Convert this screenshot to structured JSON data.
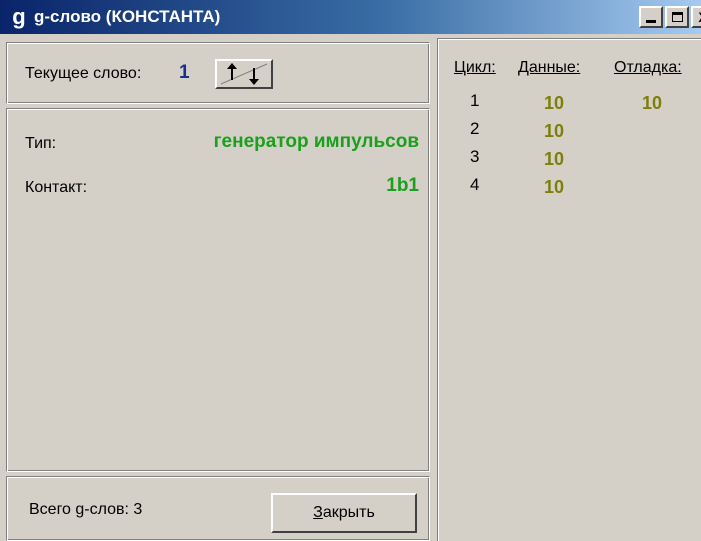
{
  "window": {
    "icon_glyph": "g",
    "title": "g-слово (КОНСТАНТА)",
    "buttons": {
      "close_glyph": "X"
    }
  },
  "current_word": {
    "label": "Текущее слово:",
    "value": "1",
    "swap_icon": "arrows-up-down-icon"
  },
  "info": {
    "type_label": "Тип:",
    "type_value": "генератор импульсов",
    "contact_label": "Контакт:",
    "contact_value": "1b1"
  },
  "footer": {
    "total_label": "Всего g-слов: 3",
    "close_button_mnemonic": "З",
    "close_button_rest": "акрыть"
  },
  "table": {
    "headers": {
      "cycle": "Цикл:",
      "data": "Данные:",
      "debug": "Отладка:"
    },
    "rows": [
      {
        "cycle": "1",
        "data": "10",
        "debug": "10"
      },
      {
        "cycle": "2",
        "data": "10",
        "debug": ""
      },
      {
        "cycle": "3",
        "data": "10",
        "debug": ""
      },
      {
        "cycle": "4",
        "data": "10",
        "debug": ""
      }
    ]
  },
  "colors": {
    "title_bar": "#0a246a",
    "window_bg": "#d4d0c8",
    "word_value": "#1c2e8c",
    "green_value": "#1aa01a",
    "olive_value": "#7e7e08"
  }
}
